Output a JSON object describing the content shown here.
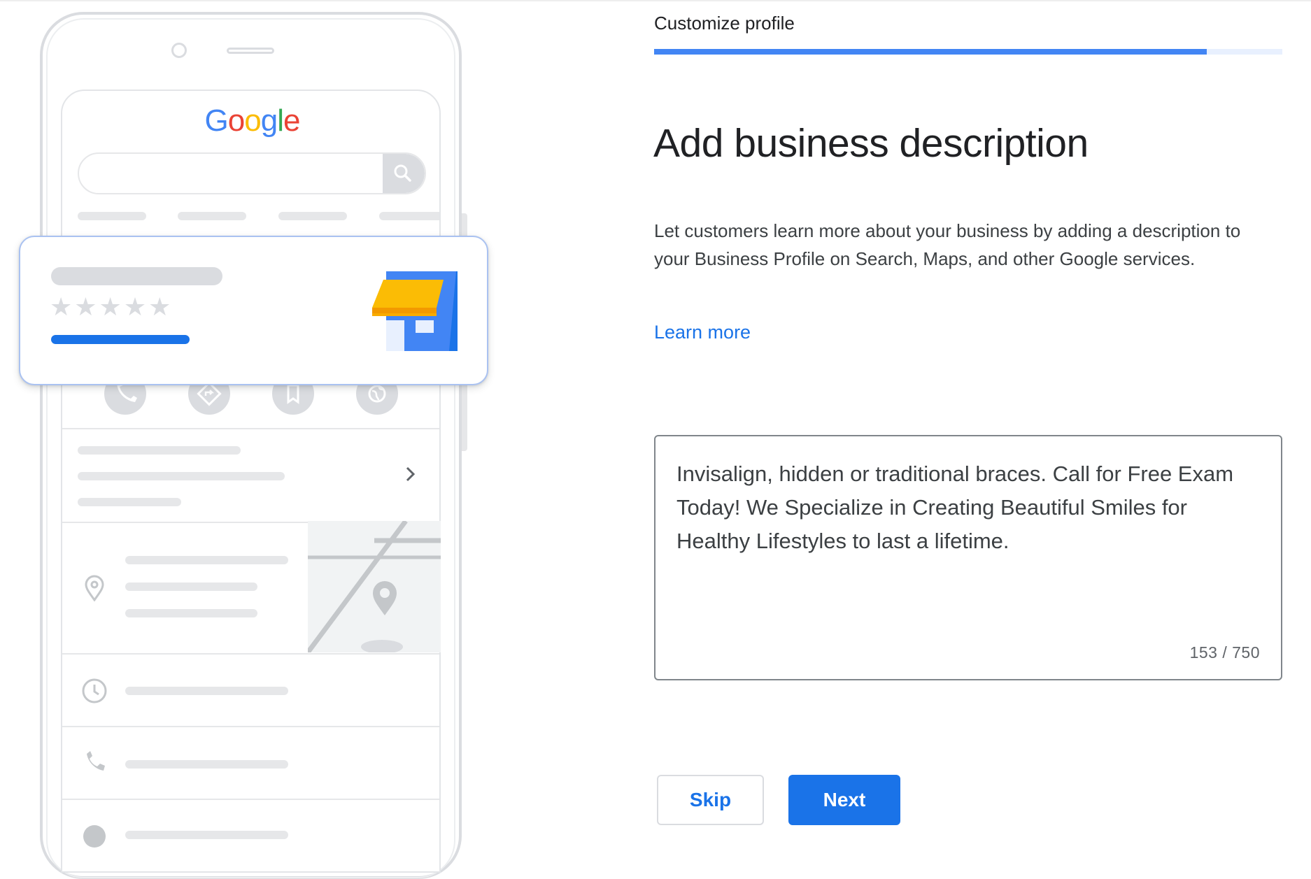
{
  "illustration": {
    "logo_letters": [
      {
        "ch": "G",
        "color": "#4285f4"
      },
      {
        "ch": "o",
        "color": "#ea4335"
      },
      {
        "ch": "o",
        "color": "#fbbc05"
      },
      {
        "ch": "g",
        "color": "#4285f4"
      },
      {
        "ch": "l",
        "color": "#34a853"
      },
      {
        "ch": "e",
        "color": "#ea4335"
      }
    ],
    "stars": "★★★★★",
    "icons": [
      "search-icon",
      "storefront-icon",
      "phone-icon",
      "directions-icon",
      "bookmark-icon",
      "globe-icon",
      "chevron-right-icon",
      "location-pin-icon",
      "clock-icon"
    ],
    "colors": {
      "brand_blue": "#1a73e8",
      "awning_yellow": "#fbbc05"
    }
  },
  "step": {
    "title": "Customize profile",
    "progress_percent": 88
  },
  "main": {
    "heading": "Add business description",
    "description": "Let customers learn more about your business by adding a description to your Business Profile on Search, Maps, and other Google services.",
    "learn_more_label": "Learn more"
  },
  "textarea": {
    "value": "Invisalign, hidden or traditional braces. Call for Free Exam Today! We Specialize in Creating Beautiful Smiles for Healthy Lifestyles to last a lifetime.",
    "counter": "153 / 750"
  },
  "buttons": {
    "skip_label": "Skip",
    "next_label": "Next"
  }
}
